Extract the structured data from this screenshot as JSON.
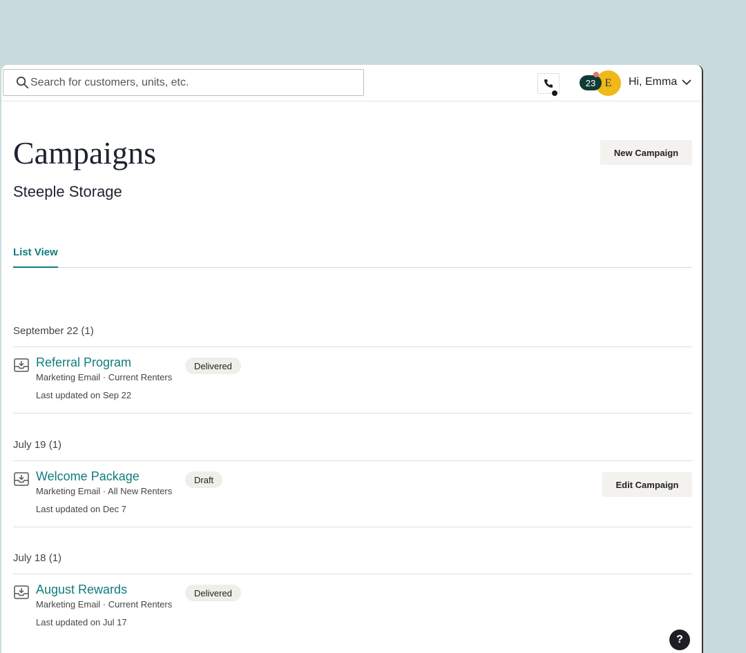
{
  "search": {
    "placeholder": "Search for customers, units, etc."
  },
  "header": {
    "notification_count": "23",
    "avatar_initial": "E",
    "greeting": "Hi, Emma"
  },
  "page": {
    "title": "Campaigns",
    "subtitle": "Steeple Storage",
    "new_campaign_label": "New Campaign"
  },
  "tabs": {
    "active": "List View"
  },
  "groups": [
    {
      "header": "September 22 (1)",
      "campaign": {
        "title": "Referral Program",
        "meta": "Marketing Email · Current Renters",
        "updated": "Last updated on Sep 22",
        "status": "Delivered"
      }
    },
    {
      "header": "July 19 (1)",
      "campaign": {
        "title": "Welcome Package",
        "meta": "Marketing Email · All New Renters",
        "updated": "Last updated on Dec 7",
        "status": "Draft",
        "action_label": "Edit Campaign"
      }
    },
    {
      "header": "July 18 (1)",
      "campaign": {
        "title": "August Rewards",
        "meta": "Marketing Email · Current Renters",
        "updated": "Last updated on Jul 17",
        "status": "Delivered"
      }
    }
  ],
  "help": {
    "label": "?"
  },
  "colors": {
    "accent": "#107c7d",
    "badge_bg": "#0f3a36",
    "avatar_bg": "#f0b818",
    "background": "#c9dadd"
  },
  "icons": {
    "search": "search-icon",
    "phone": "phone-icon",
    "chevron": "chevron-down-icon",
    "campaign": "inbox-download-icon"
  }
}
